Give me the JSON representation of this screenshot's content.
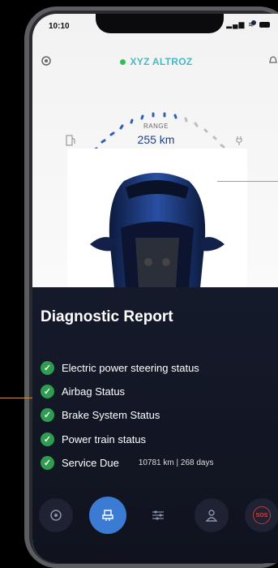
{
  "status_bar": {
    "time": "10:10",
    "signal": "▂▄▆",
    "wifi": "≋"
  },
  "header": {
    "car_name": "XYZ ALTROZ",
    "connection_status_color": "#2fbf55",
    "left_icon": "gear-icon",
    "right_icon": "bell-icon"
  },
  "range": {
    "label": "RANGE",
    "value": "255 km",
    "left_icon": "fuel-pump-icon",
    "right_icon": "charging-plug-icon"
  },
  "diagnostic": {
    "title": "Diagnostic Report",
    "items": [
      {
        "label": "Electric power steering status"
      },
      {
        "label": "Airbag Status"
      },
      {
        "label": "Brake System Status"
      },
      {
        "label": "Power train status"
      },
      {
        "label": "Service Due",
        "detail": "10781 km | 268 days"
      }
    ]
  },
  "navbar": {
    "items": [
      {
        "icon": "steering-wheel-icon",
        "active": false
      },
      {
        "icon": "car-seat-icon",
        "active": true
      },
      {
        "icon": "sliders-icon",
        "active": false
      },
      {
        "icon": "user-icon",
        "active": false
      },
      {
        "icon": "sos-icon",
        "label": "SOS",
        "active": false
      }
    ]
  },
  "colors": {
    "accent": "#3b7bd4",
    "panel": "#151a2b",
    "check": "#2e9d4f",
    "brand_text": "#47b8c4"
  }
}
